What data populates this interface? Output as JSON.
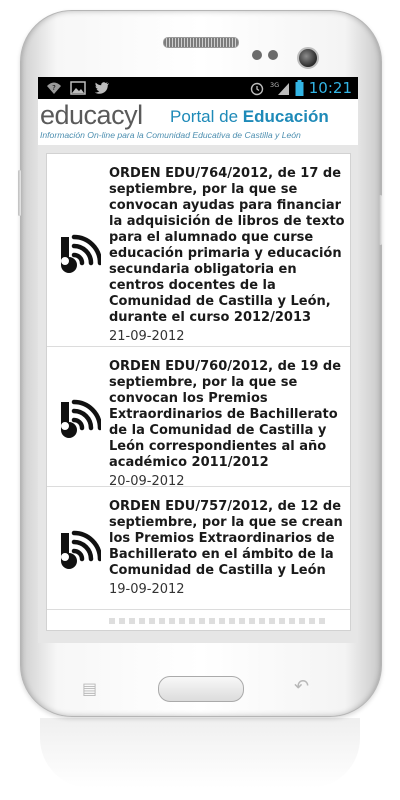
{
  "statusbar": {
    "time": "10:21",
    "network": "3G",
    "icons": [
      "wifi-question-icon",
      "image-icon",
      "twitter-icon",
      "alarm-icon",
      "signal-icon",
      "battery-icon"
    ]
  },
  "header": {
    "brand": "educacyl",
    "portal_prefix": "Portal de ",
    "portal_bold": "Educación",
    "tagline": "Información On-line para la Comunidad Educativa de Castilla y León"
  },
  "news": [
    {
      "title": "ORDEN EDU/764/2012, de 17 de septiembre, por la que se convocan ayudas para financiar la adquisición de libros de texto para el alumnado que curse educación primaria y educación secundaria obligatoria en centros docentes de la Comunidad de Castilla y León, durante el curso 2012/2013",
      "date": "21-09-2012"
    },
    {
      "title": "ORDEN EDU/760/2012, de 19 de septiembre, por la que se convocan los Premios Extraordinarios de Bachillerato de la Comunidad de Castilla y León correspondientes al año académico 2011/2012",
      "date": "20-09-2012"
    },
    {
      "title": "ORDEN EDU/757/2012, de 12 de septiembre, por la que se crean los Premios Extraordinarios de Bachillerato en el ámbito de la Comunidad de Castilla y León",
      "date": "19-09-2012"
    }
  ],
  "colors": {
    "accent": "#33b5e5",
    "brand_blue": "#1e8ab8",
    "text": "#1a1a1a"
  }
}
